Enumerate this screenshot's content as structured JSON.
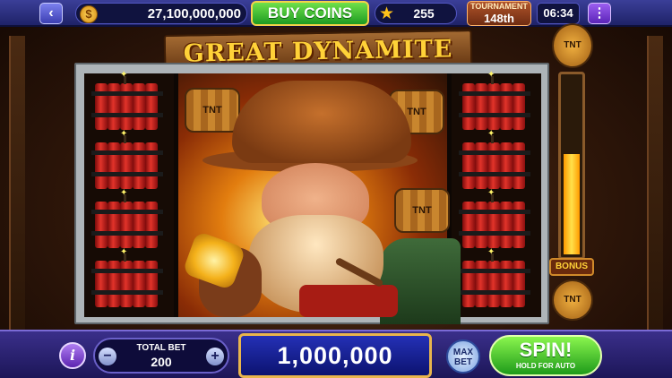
{
  "topbar": {
    "coin_balance": "27,100,000,000",
    "buy_coins_label": "BUY COINS",
    "stars": "255",
    "tournament_label": "TOURNAMENT",
    "tournament_rank": "148th",
    "clock": "06:34"
  },
  "game": {
    "title": "GREAT DYNAMITE",
    "barrel_text": "TNT",
    "bonus_label": "BONUS",
    "bonus_meter_fill": 0.55
  },
  "bottombar": {
    "info_label": "i",
    "total_bet_label": "TOTAL BET",
    "total_bet_value": "200",
    "minus_label": "−",
    "plus_label": "+",
    "win_amount": "1,000,000",
    "max_bet_line1": "MAX",
    "max_bet_line2": "BET",
    "spin_label": "SPIN!",
    "spin_sublabel": "HOLD FOR AUTO"
  },
  "icons": {
    "back": "back-arrow-icon",
    "coin": "coin-icon",
    "star": "star-icon",
    "menu": "menu-dots-icon"
  }
}
